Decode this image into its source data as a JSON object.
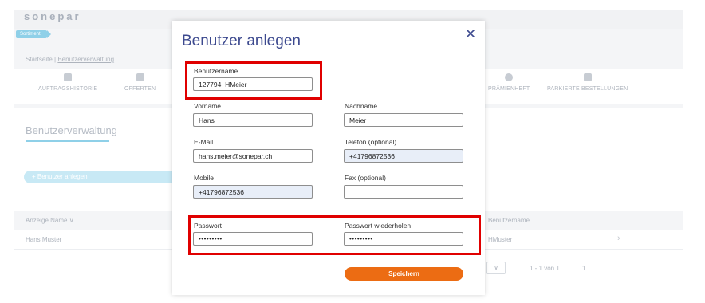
{
  "background": {
    "logo": "sonepar",
    "sortiment_tag": "Sortiment",
    "breadcrumb": {
      "home": "Startseite",
      "separator": "|",
      "current": "Benutzerverwaltung"
    },
    "nav": [
      {
        "label": "AUFTRAGSHISTORIE",
        "icon": "order-history-icon"
      },
      {
        "label": "OFFERTEN",
        "icon": "quotes-icon"
      },
      {
        "label": "PRÄMIENHEFT",
        "icon": "rewards-icon"
      },
      {
        "label": "PARKIERTE BESTELLUNGEN",
        "icon": "cart-icon"
      }
    ],
    "page_title": "Benutzerverwaltung",
    "add_user_label": "+  Benutzer anlegen",
    "table": {
      "headers": [
        "Anzeige Name",
        "Benutzername"
      ],
      "rows": [
        {
          "display_name": "Hans Muster",
          "username": "HMuster"
        }
      ]
    },
    "pager": {
      "text": "1 - 1 von 1",
      "page": "1"
    }
  },
  "modal": {
    "title": "Benutzer anlegen",
    "fields": {
      "username": {
        "label": "Benutzername",
        "value": "127794  HMeier"
      },
      "firstname": {
        "label": "Vorname",
        "value": "Hans"
      },
      "lastname": {
        "label": "Nachname",
        "value": "Meier"
      },
      "email": {
        "label": "E-Mail",
        "value": "hans.meier@sonepar.ch"
      },
      "phone": {
        "label": "Telefon (optional)",
        "value": "+41796872536"
      },
      "mobile": {
        "label": "Mobile",
        "value": "+41796872536"
      },
      "fax": {
        "label": "Fax (optional)",
        "value": ""
      },
      "password": {
        "label": "Passwort",
        "value": "•••••••••"
      },
      "password_repeat": {
        "label": "Passwort wiederholen",
        "value": "•••••••••"
      }
    },
    "save_label": "Speichern"
  },
  "colors": {
    "accent": "#ec6c13",
    "title": "#3d4a8f",
    "highlight": "#e00000",
    "autofill": "#e8eef8"
  }
}
